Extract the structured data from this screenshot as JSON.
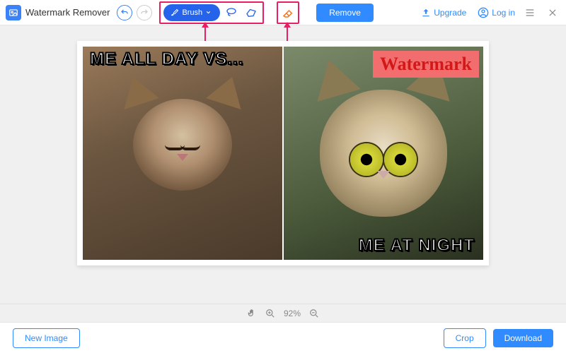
{
  "app": {
    "title": "Watermark Remover"
  },
  "toolbar": {
    "brush_label": "Brush",
    "remove_label": "Remove",
    "upgrade_label": "Upgrade",
    "login_label": "Log in"
  },
  "canvas": {
    "meme_top": "ME ALL DAY VS...",
    "meme_bottom": "ME AT NIGHT",
    "watermark_text": "Watermark"
  },
  "zoom": {
    "level": "92%"
  },
  "bottom": {
    "new_image": "New Image",
    "crop": "Crop",
    "download": "Download"
  },
  "colors": {
    "accent": "#2f8bff",
    "highlight": "#e91e63"
  }
}
